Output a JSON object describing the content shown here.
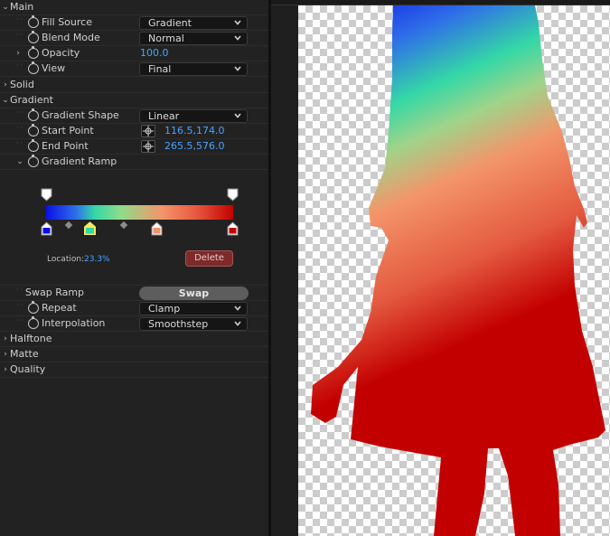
{
  "sections": {
    "main": "Main",
    "solid": "Solid",
    "gradient": "Gradient",
    "halftone": "Halftone",
    "matte": "Matte",
    "quality": "Quality"
  },
  "main": {
    "fill_source": {
      "label": "Fill Source",
      "value": "Gradient"
    },
    "blend_mode": {
      "label": "Blend Mode",
      "value": "Normal"
    },
    "opacity": {
      "label": "Opacity",
      "value": "100.0"
    },
    "view": {
      "label": "View",
      "value": "Final"
    }
  },
  "gradient": {
    "shape": {
      "label": "Gradient Shape",
      "value": "Linear"
    },
    "start_point": {
      "label": "Start Point",
      "value": "116.5,174.0"
    },
    "end_point": {
      "label": "End Point",
      "value": "265.5,576.0"
    },
    "ramp": {
      "label": "Gradient Ramp",
      "location_label": "Location:",
      "location_value": "23.3%",
      "delete_label": "Delete",
      "color_stops": [
        {
          "color": "#0a10e6",
          "position": 0.0
        },
        {
          "color": "#34d8a6",
          "position": 0.233,
          "selected": true
        },
        {
          "color": "#f3956a",
          "position": 0.593
        },
        {
          "color": "#c30000",
          "position": 1.0
        }
      ],
      "opacity_stops": [
        {
          "position": 0.0
        },
        {
          "position": 1.0
        }
      ]
    },
    "swap_ramp": {
      "label": "Swap Ramp",
      "button": "Swap"
    },
    "repeat": {
      "label": "Repeat",
      "value": "Clamp"
    },
    "interpolation": {
      "label": "Interpolation",
      "value": "Smoothstep"
    }
  },
  "colors": {
    "accent_blue": "#4aa3ff",
    "delete_red": "#7e2a2a",
    "panel_bg": "#222222"
  }
}
